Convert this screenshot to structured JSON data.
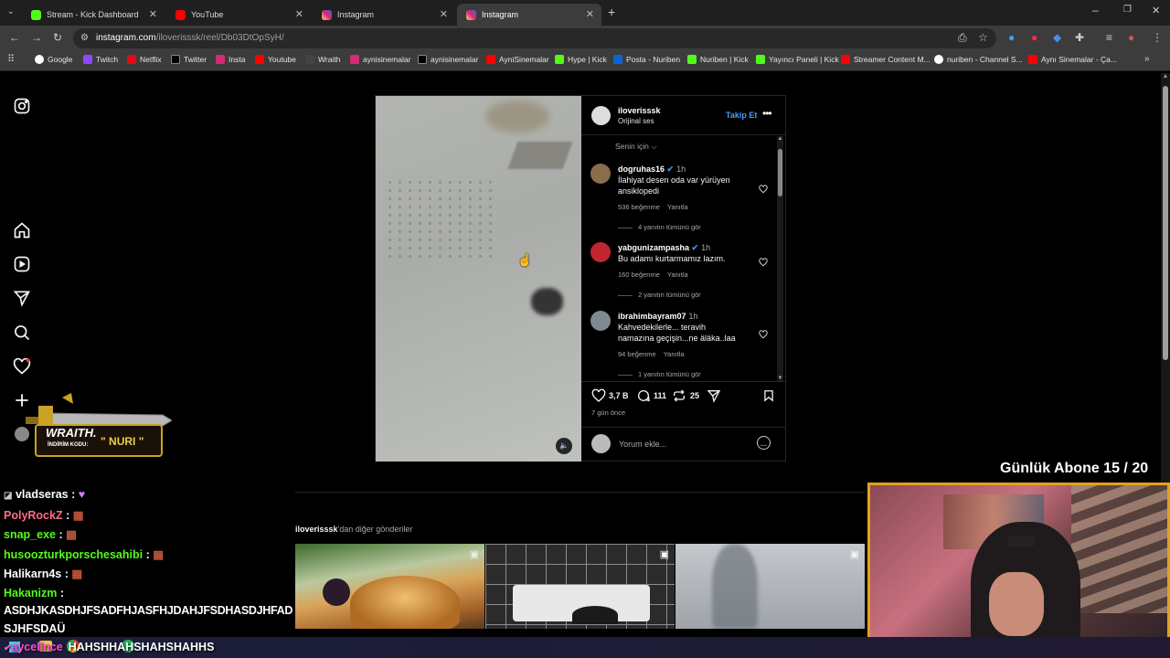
{
  "tabs": [
    {
      "label": "Stream - Kick Dashboard",
      "color": "#53fc18"
    },
    {
      "label": "YouTube",
      "color": "#ff0000"
    },
    {
      "label": "Instagram",
      "color": "#e1306c"
    },
    {
      "label": "Instagram",
      "color": "#e1306c"
    }
  ],
  "address": {
    "host": "instagram.com",
    "path": "/iloverisssk/reel/Db03DtOpSyH/"
  },
  "bookmarks": [
    "Google",
    "Twitch",
    "Netflix",
    "Twitter",
    "Insta",
    "Youtube",
    "Wraith",
    "aynisinemalar",
    "aynisinemalar",
    "AyniSinemalar",
    "Hype | Kick",
    "Posta - Nuriben",
    "Nuriben | Kick",
    "Yayıncı Paneli | Kick",
    "Streamer Content M...",
    "nuriben - Channel S...",
    "Aynı Sinemalar - Ça..."
  ],
  "post": {
    "username": "iloverisssk",
    "audio": "Orijinal ses",
    "follow": "Takip Et",
    "sort": "Senin için",
    "comments": [
      {
        "user": "dogruhas16",
        "time": "1h",
        "text": "İlahiyat desen oda var yürüyen ansiklopedi",
        "likes": "536 beğenme",
        "reply": "Yanıtla",
        "replies": "4 yanıtın tümünü gör"
      },
      {
        "user": "yabgunizampasha",
        "time": "1h",
        "text": "Bu adamı kurtarmamız lazım.",
        "likes": "160 beğenme",
        "reply": "Yanıtla",
        "replies": "2 yanıtın tümünü gör"
      },
      {
        "user": "ibrahimbayram07",
        "time": "1h",
        "text": "Kahvedekilerle... teravih namazına geçişin...ne äläka..laa",
        "likes": "94 beğenme",
        "reply": "Yanıtla",
        "replies": "1 yanıtın tümünü gör"
      }
    ],
    "like_count": "3,7 B",
    "comment_count": "111",
    "repost_count": "25",
    "date": "7 gün önce",
    "comment_placeholder": "Yorum ekle..."
  },
  "more_posts_user": "iloverisssk",
  "more_posts_suffix": "'dan diğer gönderiler",
  "overlay": {
    "sponsor_brand": "WRAITH.",
    "sponsor_code_label": "İNDİRİM KODU:",
    "sponsor_code": "\" NURI \"",
    "sub_goal": "Günlük Abone 15 / 20"
  },
  "chat": [
    {
      "user": "vladseras",
      "color": "#ffffff",
      "msg": ""
    },
    {
      "user": "PolyRockZ",
      "color": "#ff6b8b",
      "msg": ""
    },
    {
      "user": "snap_exe",
      "color": "#53fc18",
      "msg": ""
    },
    {
      "user": "husoozturkporschesahibi",
      "color": "#53fc18",
      "msg": ""
    },
    {
      "user": "Halikarn4s",
      "color": "#ffffff",
      "msg": ""
    },
    {
      "user": "Hakanizm",
      "color": "#53fc18",
      "msg": ""
    },
    {
      "user": "",
      "color": "#ffffff",
      "msg": "ASDHJKASDHJFSADFHJASFHJDAHJFSDHASDJHFAD"
    },
    {
      "user": "",
      "color": "#ffffff",
      "msg": "SJHFSDAÜ"
    },
    {
      "user": "aycellnce",
      "color": "#ff4fd8",
      "msg": "HAHSHHAHSHAHSHAHHS"
    }
  ]
}
